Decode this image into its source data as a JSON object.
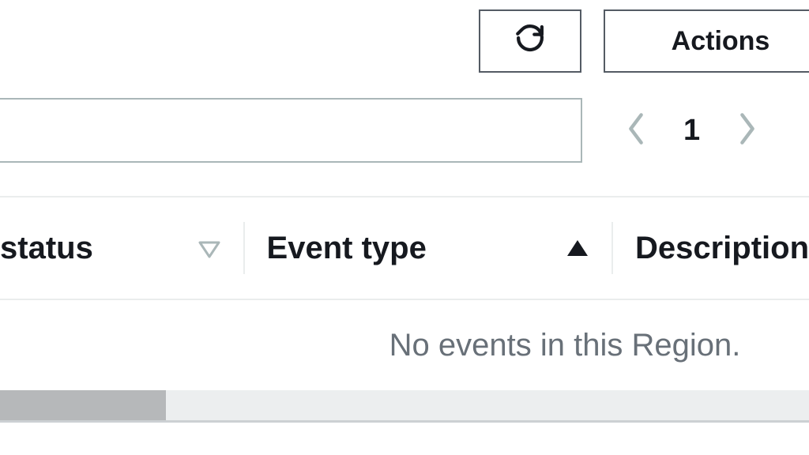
{
  "toolbar": {
    "refresh_aria": "Refresh",
    "actions_label": "Actions"
  },
  "filter": {
    "value": ""
  },
  "pagination": {
    "current": "1",
    "prev_aria": "Previous page",
    "next_aria": "Next page"
  },
  "columns": {
    "status": {
      "label": "status",
      "sort": "none"
    },
    "event_type": {
      "label": "Event type",
      "sort": "asc"
    },
    "description": {
      "label": "Description",
      "sort": "none"
    }
  },
  "table": {
    "rows": [],
    "empty_message": "No events in this Region."
  },
  "icons": {
    "refresh": "refresh-icon",
    "chevron_left": "chevron-left-icon",
    "chevron_right": "chevron-right-icon",
    "sort_hollow": "sort-outline-icon",
    "sort_asc": "sort-asc-icon"
  }
}
